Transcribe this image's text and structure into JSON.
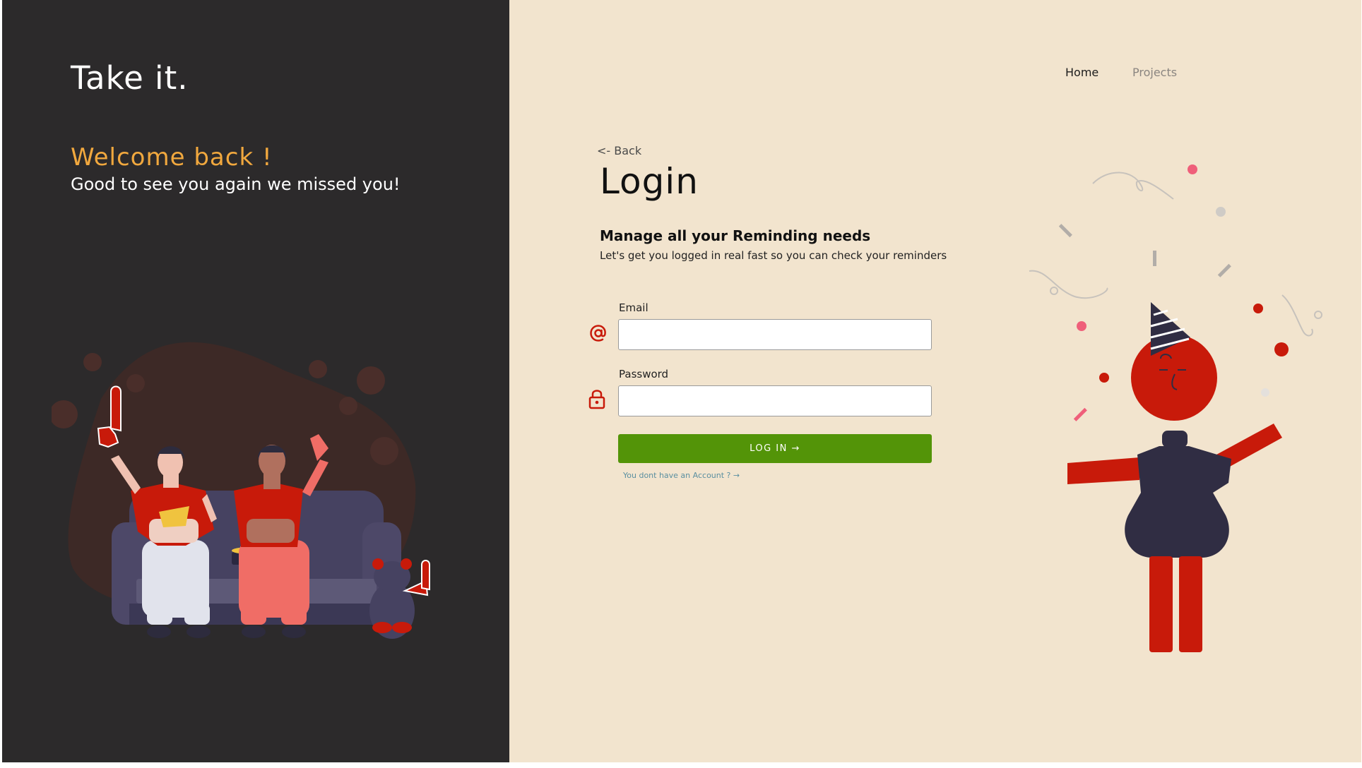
{
  "left_panel": {
    "brand": "Take it.",
    "welcome_title": "Welcome back !",
    "welcome_subtitle": "Good to see you again we missed you!"
  },
  "nav": {
    "home": "Home",
    "projects": "Projects"
  },
  "login": {
    "back": "<- Back",
    "title": "Login",
    "subtitle": "Manage all your Reminding needs",
    "description": "Let's get you logged in real fast so you can check your reminders",
    "email_label": "Email",
    "email_value": "",
    "password_label": "Password",
    "password_value": "",
    "submit_label": "LOG IN →",
    "signup_link": "You dont have an Account ? →"
  },
  "colors": {
    "left_bg": "#2c2a2b",
    "right_bg": "#f2e4ce",
    "accent_orange": "#f1a83e",
    "accent_red": "#c81a0a",
    "button_green": "#539408",
    "figure_navy": "#302d43"
  },
  "icons": {
    "email": "at-sign-icon",
    "password": "lock-icon"
  }
}
